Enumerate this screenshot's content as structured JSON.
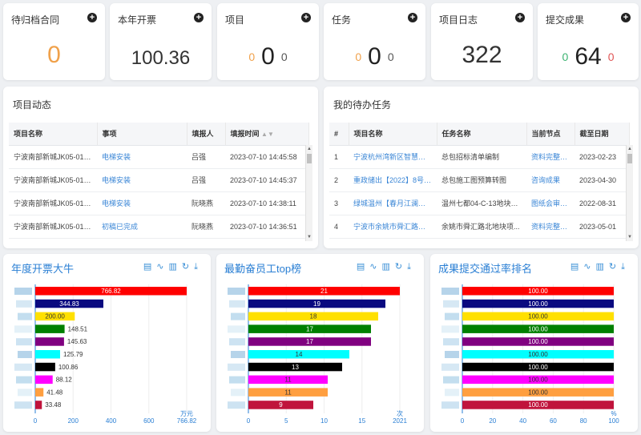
{
  "stats": [
    {
      "title": "待归档合同",
      "value": "0"
    },
    {
      "title": "本年开票",
      "value": "100.36"
    },
    {
      "title": "项目",
      "left": "0",
      "mid": "0",
      "right": "0"
    },
    {
      "title": "任务",
      "left": "0",
      "mid": "0",
      "right": "0"
    },
    {
      "title": "项目日志",
      "value": "322"
    },
    {
      "title": "提交成果",
      "left": "0",
      "mid": "64",
      "right": "0"
    }
  ],
  "project_panel": {
    "title": "项目动态",
    "headers": [
      "项目名称",
      "事项",
      "填报人",
      "填报时间"
    ],
    "rows": [
      [
        "宁波南部新城JK05-01-0...",
        "电梯安装",
        "吕强",
        "2023-07-10 14:45:58"
      ],
      [
        "宁波南部新城JK05-01-0...",
        "电梯安装",
        "吕强",
        "2023-07-10 14:45:37"
      ],
      [
        "宁波南部新城JK05-01-0...",
        "电梯安装",
        "阮晓燕",
        "2023-07-10 14:38:11"
      ],
      [
        "宁波南部新城JK05-01-0...",
        "初稿已完成",
        "阮晓燕",
        "2023-07-10 14:36:51"
      ]
    ]
  },
  "task_panel": {
    "title": "我的待办任务",
    "headers": [
      "#",
      "项目名称",
      "任务名称",
      "当前节点",
      "截至日期"
    ],
    "rows": [
      [
        "1",
        "宁波杭州湾新区智慧宜居 4(",
        "总包招标清单编制",
        "资料完整性审",
        "2023-02-23"
      ],
      [
        "2",
        "重政储出【2022】8号地块",
        "总包施工图预算转图",
        "咨询成果",
        "2023-04-30"
      ],
      [
        "3",
        "绿城温州【春月江澜】一期",
        "温州七都04-C-13地块总...",
        "图纸会审及优(",
        "2022-08-31"
      ],
      [
        "4",
        "宁波市余姚市舜汇路北地块",
        "余姚市舜汇路北地块项...",
        "资料完整性审",
        "2023-05-01"
      ]
    ]
  },
  "tool_icons": [
    "document-icon",
    "line-chart-icon",
    "bar-chart-icon",
    "refresh-icon",
    "download-icon"
  ],
  "chart_data": [
    {
      "type": "bar",
      "orientation": "horizontal",
      "title": "年度开票大牛",
      "values": [
        766.82,
        344.83,
        200.0,
        148.51,
        145.63,
        125.79,
        100.86,
        88.12,
        41.48,
        33.48
      ],
      "labels": [
        "766.82",
        "344.83",
        "200.00",
        "148.51",
        "145.63",
        "125.79",
        "100.86",
        "88.12",
        "41.48",
        "33.48"
      ],
      "colors": [
        "#ff0000",
        "#0a0a80",
        "#ffe000",
        "#008000",
        "#800080",
        "#00ffff",
        "#000000",
        "#ff00ff",
        "#ff9f40",
        "#c0143c"
      ],
      "xticks": [
        "0",
        "200",
        "400",
        "600",
        "766.82"
      ],
      "xmax": 766.82,
      "unit": "万元"
    },
    {
      "type": "bar",
      "orientation": "horizontal",
      "title": "最勤奋员工top榜",
      "values": [
        21,
        19,
        18,
        17,
        17,
        14,
        13,
        11,
        11,
        9
      ],
      "labels": [
        "21",
        "19",
        "18",
        "17",
        "17",
        "14",
        "13",
        "11",
        "11",
        "9"
      ],
      "colors": [
        "#ff0000",
        "#0a0a80",
        "#ffe000",
        "#008000",
        "#800080",
        "#00ffff",
        "#000000",
        "#ff00ff",
        "#ff9f40",
        "#c0143c"
      ],
      "xticks": [
        "0",
        "5",
        "10",
        "15",
        "2021"
      ],
      "xmax": 21,
      "unit": "次"
    },
    {
      "type": "bar",
      "orientation": "horizontal",
      "title": "成果提交通过率排名",
      "values": [
        100,
        100,
        100,
        100,
        100,
        100,
        100,
        100,
        100,
        100
      ],
      "labels": [
        "100.00",
        "100.00",
        "100.00",
        "100.00",
        "100.00",
        "100.00",
        "100.00",
        "100.00",
        "100.00",
        "100.00"
      ],
      "colors": [
        "#ff0000",
        "#0a0a80",
        "#ffe000",
        "#008000",
        "#800080",
        "#00ffff",
        "#000000",
        "#ff00ff",
        "#ff9f40",
        "#c0143c"
      ],
      "xticks": [
        "0",
        "20",
        "40",
        "60",
        "80",
        "100"
      ],
      "xmax": 100,
      "unit": "%"
    }
  ]
}
